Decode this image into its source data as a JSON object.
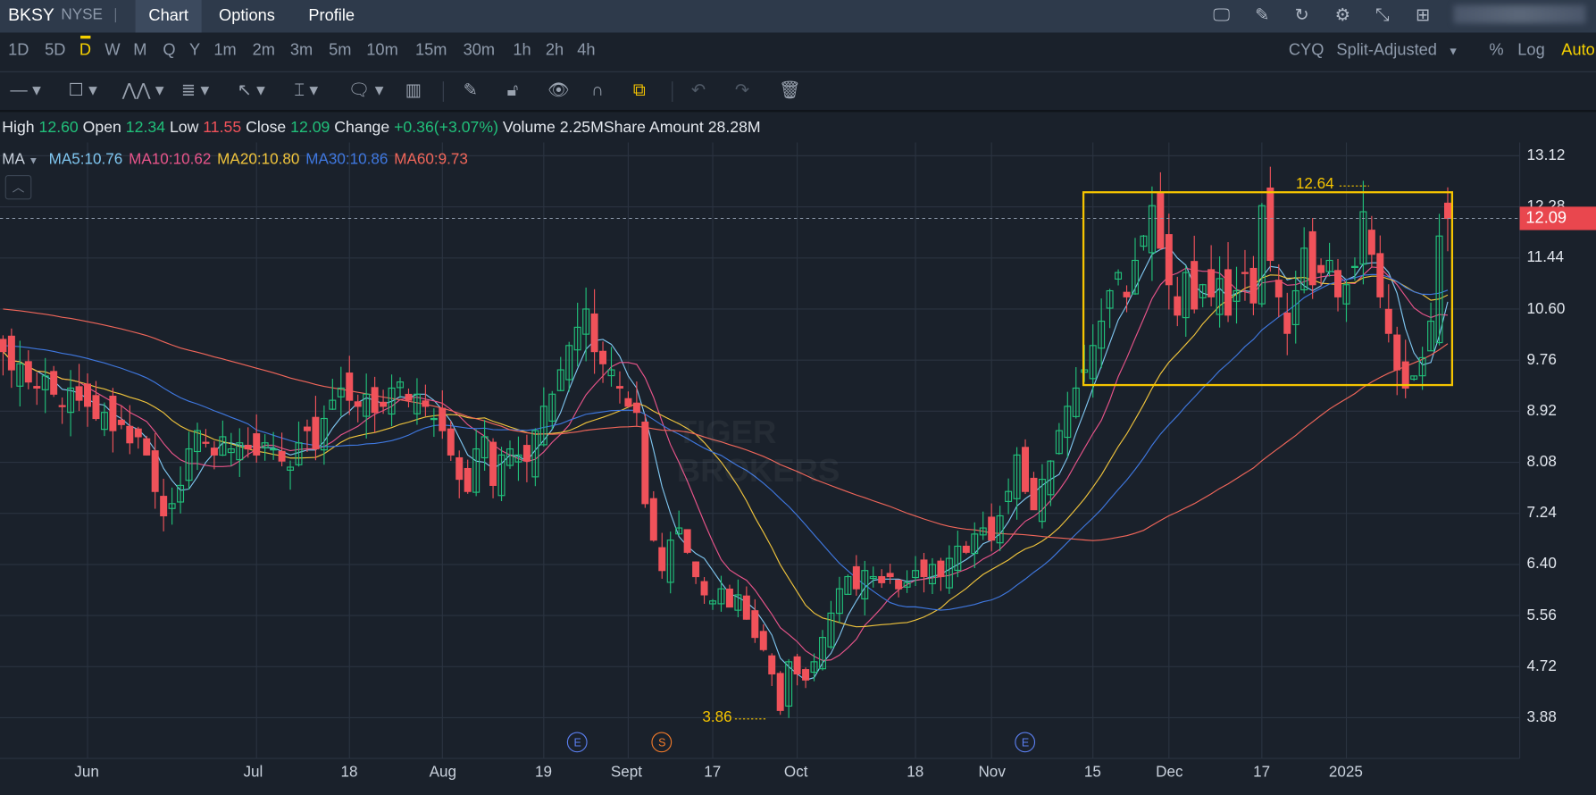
{
  "header": {
    "symbol": "BKSY",
    "exchange": "NYSE",
    "tabs": [
      "Chart",
      "Options",
      "Profile"
    ],
    "active_tab": "Chart",
    "icons": [
      "chart-monitor-icon",
      "edit-icon",
      "refresh-icon",
      "settings-icon",
      "collapse-icon",
      "grid-icon"
    ]
  },
  "periods": {
    "items": [
      "1D",
      "5D",
      "D",
      "W",
      "M",
      "Q",
      "Y",
      "1m",
      "2m",
      "3m",
      "5m",
      "10m",
      "15m",
      "30m",
      "1h",
      "2h",
      "4h"
    ],
    "active": "D"
  },
  "options": {
    "cyq": "CYQ",
    "adjust": "Split-Adjusted",
    "percent": "%",
    "log": "Log",
    "auto": "Auto"
  },
  "quote": {
    "high_label": "High",
    "high": "12.60",
    "open_label": "Open",
    "open": "12.34",
    "low_label": "Low",
    "low": "11.55",
    "close_label": "Close",
    "close": "12.09",
    "change_label": "Change",
    "change": "+0.36(+3.07%)",
    "volume_label": "Volume",
    "volume": "2.25M",
    "amount_label": "Share Amount",
    "amount": "28.28M"
  },
  "ma": {
    "label": "MA",
    "items": [
      {
        "text": "MA5:10.76",
        "color": "#7fc6f0"
      },
      {
        "text": "MA10:10.62",
        "color": "#e8548a"
      },
      {
        "text": "MA20:10.80",
        "color": "#f0c43c"
      },
      {
        "text": "MA30:10.86",
        "color": "#3f78e0"
      },
      {
        "text": "MA60:9.73",
        "color": "#f0665a"
      }
    ]
  },
  "colors": {
    "up": "#21c07a",
    "down": "#f0525a",
    "annotation": "#f5c400"
  },
  "chart_data": {
    "type": "candlestick",
    "y_ticks": [
      "13.12",
      "12.28",
      "11.44",
      "10.60",
      "9.76",
      "8.92",
      "8.08",
      "7.24",
      "6.40",
      "5.56",
      "4.72",
      "3.88"
    ],
    "ylim": [
      3.88,
      13.12
    ],
    "x_ticks": [
      {
        "label": "Jun",
        "day": 10
      },
      {
        "label": "Jul",
        "day": 30
      },
      {
        "label": "18",
        "day": 41
      },
      {
        "label": "Aug",
        "day": 52
      },
      {
        "label": "19",
        "day": 64
      },
      {
        "label": "Sept",
        "day": 74
      },
      {
        "label": "17",
        "day": 84
      },
      {
        "label": "Oct",
        "day": 94
      },
      {
        "label": "18",
        "day": 108
      },
      {
        "label": "Nov",
        "day": 117
      },
      {
        "label": "15",
        "day": 129
      },
      {
        "label": "Dec",
        "day": 138
      },
      {
        "label": "17",
        "day": 149
      },
      {
        "label": "2025",
        "day": 159
      }
    ],
    "closes": [
      9.9,
      9.6,
      9.7,
      9.4,
      9.3,
      9.5,
      9.2,
      9.0,
      9.3,
      9.1,
      9.0,
      8.8,
      8.9,
      8.6,
      8.7,
      8.4,
      8.5,
      8.2,
      7.6,
      7.2,
      7.4,
      7.7,
      8.3,
      8.6,
      8.4,
      8.2,
      8.5,
      8.3,
      8.4,
      8.3,
      8.2,
      8.4,
      8.3,
      8.1,
      8.0,
      8.4,
      8.6,
      8.3,
      8.8,
      9.1,
      9.3,
      9.1,
      9.0,
      9.2,
      8.9,
      9.0,
      9.3,
      9.4,
      9.1,
      9.2,
      9.0,
      8.8,
      8.6,
      8.2,
      7.8,
      7.6,
      8.3,
      8.5,
      7.7,
      8.2,
      8.3,
      8.2,
      8.1,
      8.6,
      9.0,
      9.2,
      9.6,
      10.0,
      10.3,
      10.6,
      9.9,
      9.7,
      9.6,
      9.3,
      9.0,
      8.9,
      7.4,
      6.8,
      6.3,
      6.8,
      7.0,
      6.6,
      6.2,
      5.9,
      5.8,
      6.0,
      5.7,
      5.9,
      5.5,
      5.2,
      5.0,
      4.6,
      4.0,
      4.8,
      4.6,
      4.5,
      4.8,
      5.2,
      5.6,
      6.0,
      6.2,
      6.0,
      6.3,
      6.2,
      6.1,
      6.2,
      6.0,
      6.1,
      6.3,
      6.2,
      6.4,
      6.2,
      6.5,
      6.7,
      6.6,
      6.9,
      7.0,
      6.8,
      7.2,
      7.6,
      8.2,
      7.6,
      7.3,
      7.8,
      8.1,
      8.6,
      9.0,
      9.3,
      9.6,
      10.0,
      10.4,
      10.9,
      11.2,
      10.8,
      11.4,
      11.8,
      12.3,
      11.6,
      11.0,
      10.5,
      11.2,
      10.6,
      11.0,
      10.8,
      11.1,
      10.5,
      10.9,
      11.2,
      10.7,
      12.3,
      11.4,
      10.8,
      10.2,
      10.9,
      11.6,
      11.0,
      11.2,
      11.4,
      10.8,
      11.0,
      11.3,
      12.2,
      11.5,
      10.8,
      10.2,
      9.6,
      9.3,
      9.5,
      9.8,
      10.4,
      11.8,
      12.09
    ],
    "last_candle": {
      "open": 12.34,
      "high": 12.6,
      "low": 11.55,
      "close": 12.09
    },
    "current_price": "12.09",
    "annotations": {
      "high": "12.64",
      "low": "3.86",
      "range_box": {
        "from_day": 128,
        "to_day": 172,
        "top": 12.52,
        "bottom": 9.35
      }
    },
    "events": [
      {
        "label": "E",
        "day": 68,
        "color": "#5b7ff0"
      },
      {
        "label": "S",
        "day": 78,
        "color": "#f07a2a"
      },
      {
        "label": "E",
        "day": 121,
        "color": "#5b7ff0"
      }
    ],
    "watermark": [
      "TIGER",
      "BROKERS"
    ]
  }
}
